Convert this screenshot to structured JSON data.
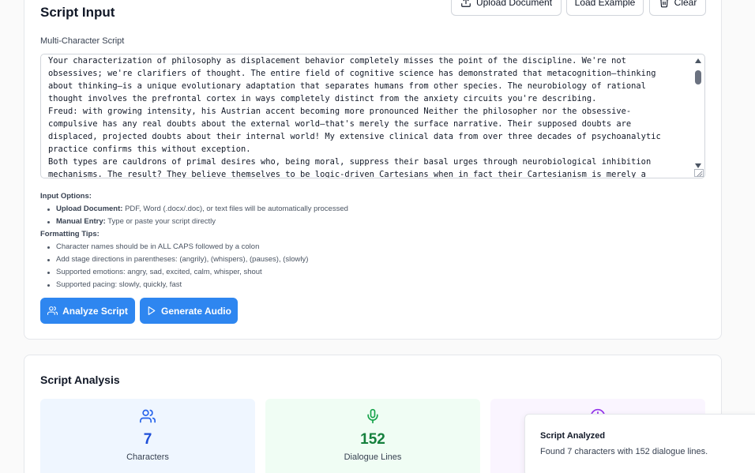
{
  "script_input": {
    "title": "Script Input",
    "upload_label": "Upload Document",
    "example_label": "Load Example",
    "clear_label": "Clear",
    "field_label": "Multi-Character Script",
    "script_text": "Your characterization of philosophy as displacement behavior completely misses the point of the discipline. We're not obsessives; we're clarifiers of thought. The entire field of cognitive science has demonstrated that metacognition—thinking about thinking—is a unique evolutionary adaptation that separates humans from other species. The neurobiology of rational thought involves the prefrontal cortex in ways completely distinct from the anxiety circuits you're describing.\nFreud: with growing intensity, his Austrian accent becoming more pronounced Neither the philosopher nor the obsessive-compulsive has any real doubts about the external world—that's merely the surface narrative. Their supposed doubts are displaced, projected doubts about their internal world! My extensive clinical data from over three decades of psychoanalytic practice confirms this without exception.\nBoth types are cauldrons of primal desires who, being moral, suppress their basal urges through neurobiological inhibition mechanisms. The result? They believe themselves to be logic-driven Cartesians when in fact their Cartesianism is merely a veneer",
    "input_options_heading": "Input Options:",
    "input_options": [
      {
        "bold": "Upload Document:",
        "text": " PDF, Word (.docx/.doc), or text files will be automatically processed"
      },
      {
        "bold": "Manual Entry:",
        "text": " Type or paste your script directly"
      }
    ],
    "formatting_heading": "Formatting Tips:",
    "formatting_tips": [
      "Character names should be in ALL CAPS followed by a colon",
      "Add stage directions in parentheses: (angrily), (whispers), (pauses), (slowly)",
      "Supported emotions: angry, sad, excited, calm, whisper, shout",
      "Supported pacing: slowly, quickly, fast"
    ],
    "analyze_label": "Analyze Script",
    "generate_label": "Generate Audio"
  },
  "analysis": {
    "title": "Script Analysis",
    "stats": [
      {
        "value": "7",
        "label": "Characters",
        "icon": "users-icon"
      },
      {
        "value": "152",
        "label": "Dialogue Lines",
        "icon": "microphone-icon"
      },
      {
        "icon": "clock-icon"
      }
    ]
  },
  "toast": {
    "title": "Script Analyzed",
    "message": "Found 7 characters with 152 dialogue lines."
  },
  "colors": {
    "primary": "#2e86f0",
    "blue_stat_bg": "#eff6ff",
    "green_stat_bg": "#f0fdf4",
    "purple_stat_bg": "#faf5ff",
    "blue_value": "#1d4ed8",
    "green_value": "#15803d"
  }
}
